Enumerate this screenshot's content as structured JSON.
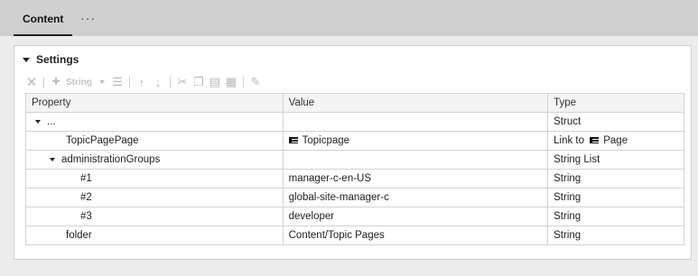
{
  "tabs": {
    "active": "Content",
    "more": "···"
  },
  "section": {
    "title": "Settings"
  },
  "toolbar": {
    "string_label": "String"
  },
  "table": {
    "headers": {
      "property": "Property",
      "value": "Value",
      "type": "Type"
    },
    "rows": [
      {
        "property": "...",
        "value": "",
        "type": "Struct",
        "depth": 0,
        "expandable": true
      },
      {
        "property": "TopicPagePage",
        "value": "Topicpage",
        "type_prefix": "Link to",
        "type": "Page",
        "depth": 1,
        "link": true
      },
      {
        "property": "administrationGroups",
        "value": "",
        "type": "String List",
        "depth": 1,
        "expandable": true
      },
      {
        "property": "#1",
        "value": "manager-c-en-US",
        "type": "String",
        "depth": 2
      },
      {
        "property": "#2",
        "value": "global-site-manager-c",
        "type": "String",
        "depth": 2
      },
      {
        "property": "#3",
        "value": "developer",
        "type": "String",
        "depth": 2
      },
      {
        "property": "folder",
        "value": "Content/Topic Pages",
        "type": "String",
        "depth": 1
      }
    ]
  },
  "icons": [
    "delete-icon",
    "add-icon",
    "caret-down-icon",
    "list-icon",
    "move-up-icon",
    "move-down-icon",
    "cut-icon",
    "copy-icon",
    "paste-icon",
    "paste-special-icon",
    "edit-icon",
    "link-icon"
  ]
}
